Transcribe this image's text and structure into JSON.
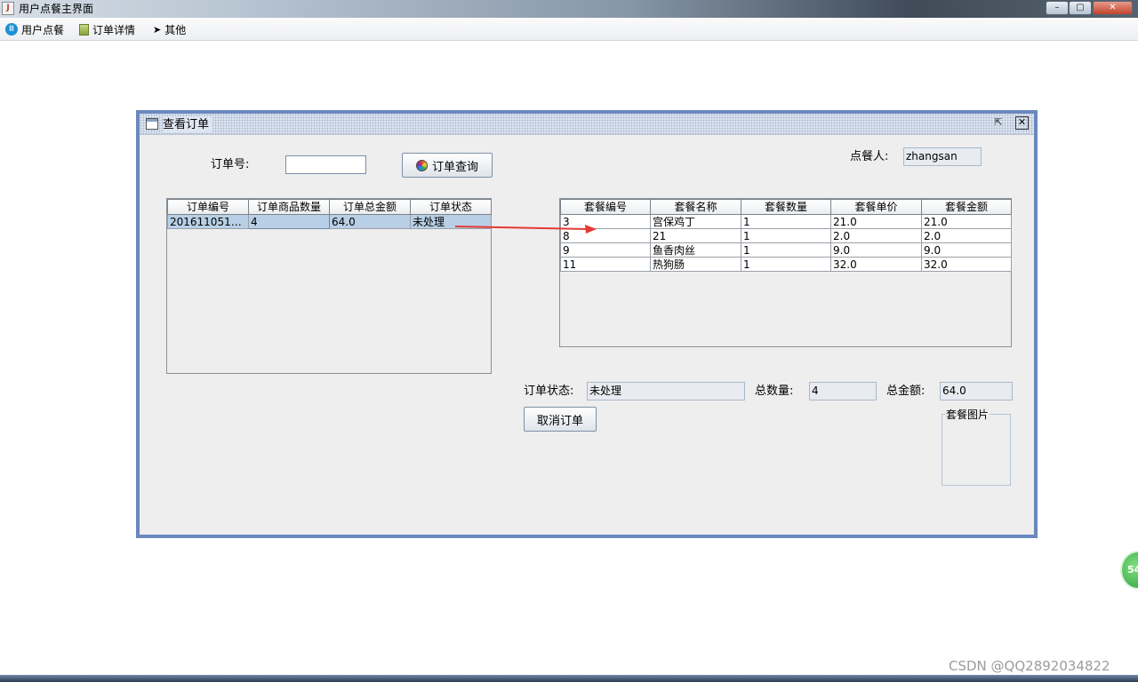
{
  "window": {
    "title": "用户点餐主界面",
    "title_icon": "java-cup-icon",
    "controls": {
      "minimize": "–",
      "maximize": "▢",
      "close": "✕"
    }
  },
  "menubar": {
    "items": [
      {
        "label": "用户点餐",
        "icon": "food-icon"
      },
      {
        "label": "订单详情",
        "icon": "calculator-icon"
      },
      {
        "label": "其他",
        "icon": "cursor-icon"
      }
    ]
  },
  "frame": {
    "title": "查看订单",
    "restore_glyph": "⇱",
    "close_glyph": "✕"
  },
  "form": {
    "order_no_label": "订单号:",
    "order_no_value": "",
    "query_button": "订单查询",
    "orderer_label": "点餐人:",
    "orderer_value": "zhangsan"
  },
  "orders_table": {
    "headers": [
      "订单编号",
      "订单商品数量",
      "订单总金额",
      "订单状态"
    ],
    "rows": [
      [
        "20161105171...",
        "4",
        "64.0",
        "未处理"
      ]
    ]
  },
  "items_table": {
    "headers": [
      "套餐编号",
      "套餐名称",
      "套餐数量",
      "套餐单价",
      "套餐金额"
    ],
    "rows": [
      [
        "3",
        "宫保鸡丁",
        "1",
        "21.0",
        "21.0"
      ],
      [
        "8",
        "21",
        "1",
        "2.0",
        "2.0"
      ],
      [
        "9",
        "鱼香肉丝",
        "1",
        "9.0",
        "9.0"
      ],
      [
        "11",
        "热狗肠",
        "1",
        "32.0",
        "32.0"
      ]
    ]
  },
  "summary": {
    "status_label": "订单状态:",
    "status_value": "未处理",
    "qty_label": "总数量:",
    "qty_value": "4",
    "amount_label": "总金额:",
    "amount_value": "64.0"
  },
  "cancel_button": "取消订单",
  "image_panel_title": "套餐图片",
  "annotation_arrow_color": "#e53935",
  "watermark": "CSDN @QQ2892034822",
  "float_badge": "54"
}
